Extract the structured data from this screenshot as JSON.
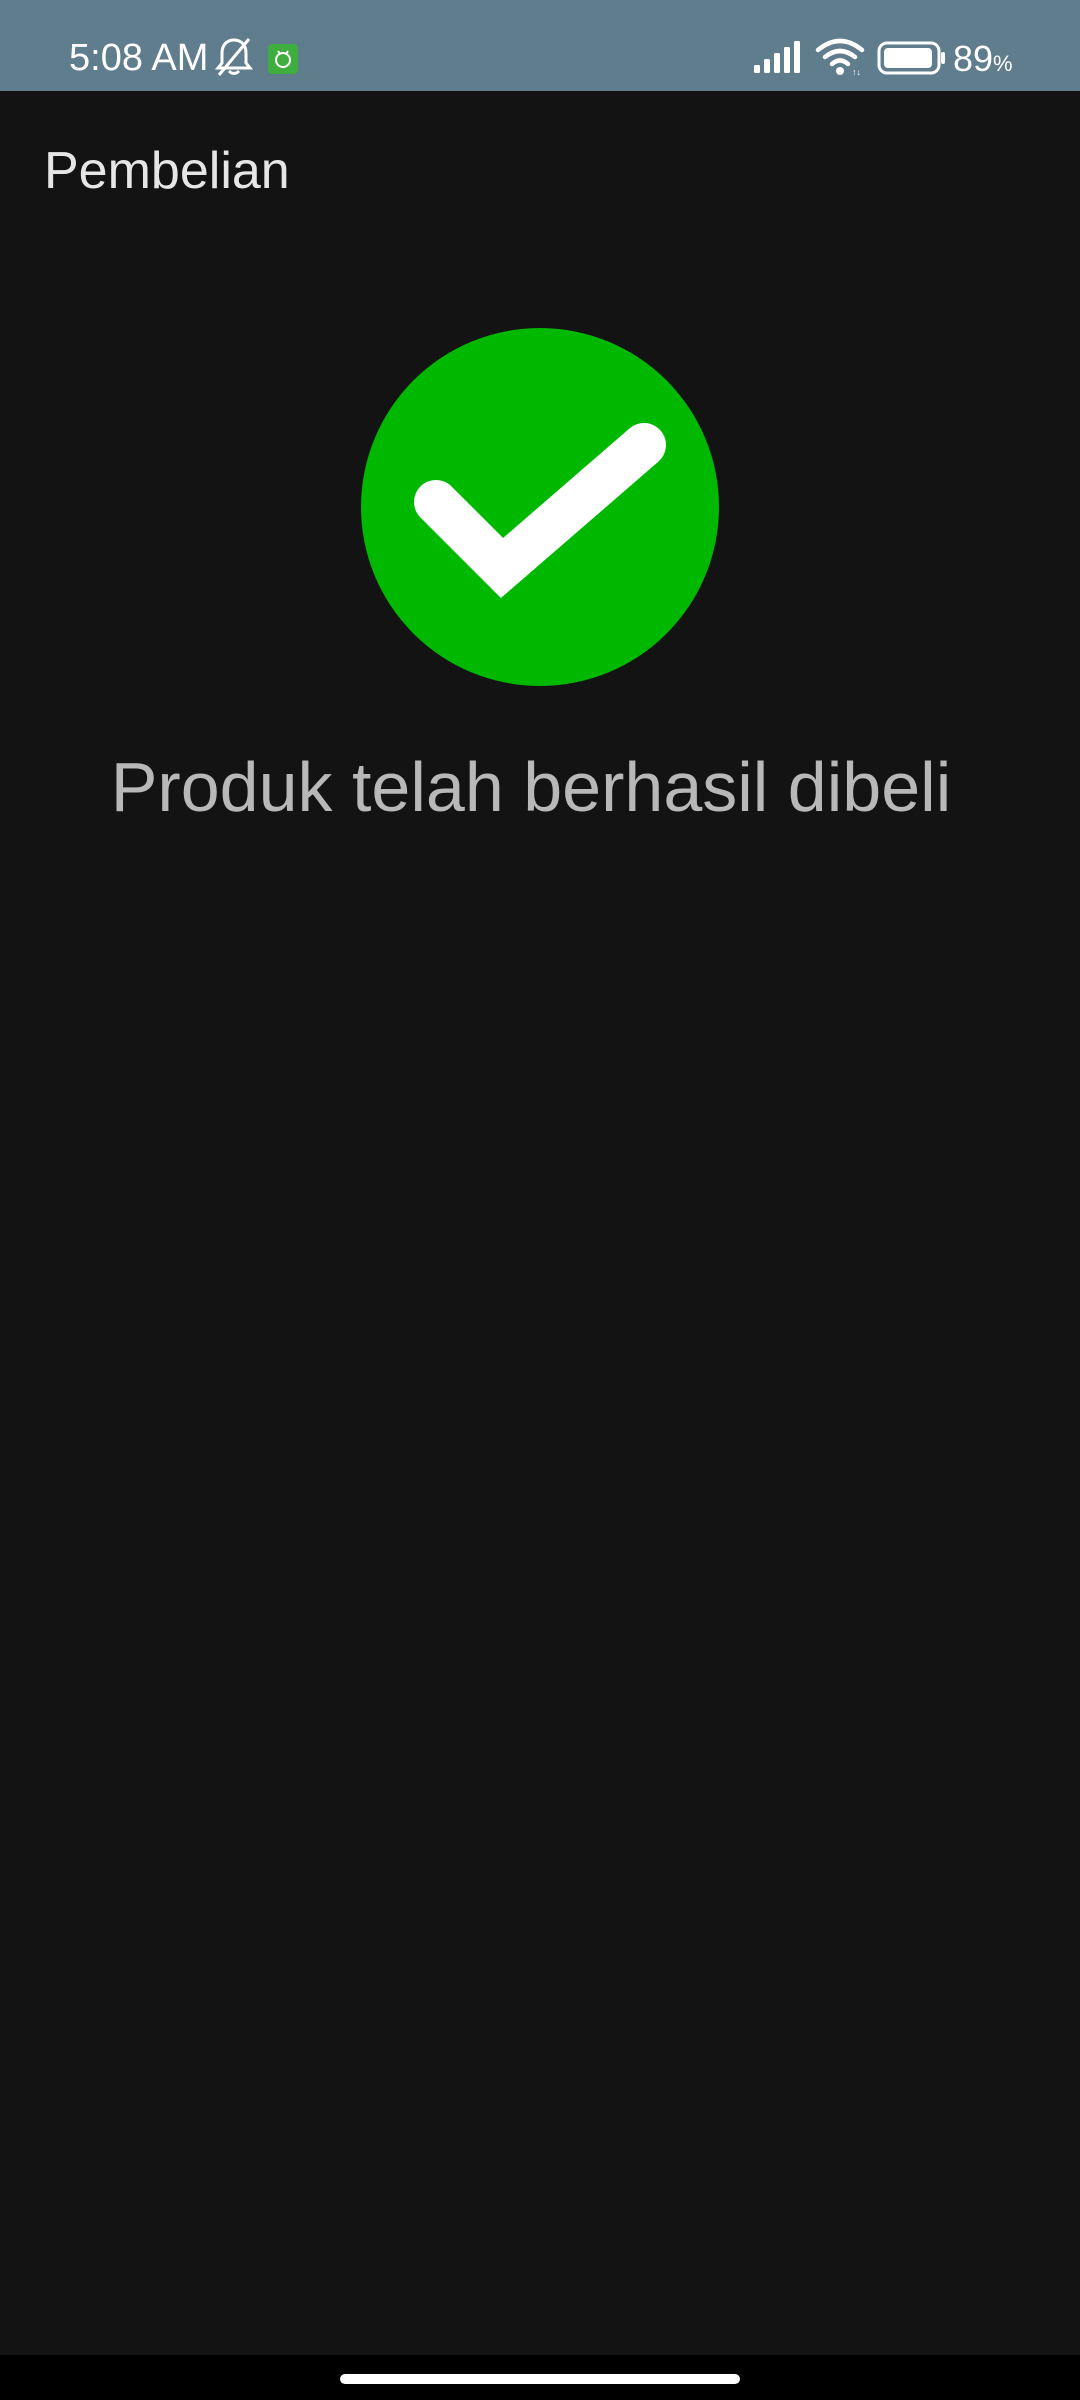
{
  "status_bar": {
    "time": "5:08 AM",
    "battery_level": "89",
    "battery_unit": "%",
    "icons": [
      "bell-off-icon",
      "app-notification-icon",
      "signal-icon",
      "wifi-icon",
      "battery-icon"
    ],
    "background_color": "#5f7d8c"
  },
  "app_bar": {
    "title": "Pembelian"
  },
  "main": {
    "success_icon": "check-circle-icon",
    "success_color": "#00b800",
    "message": "Produk telah berhasil dibeli"
  },
  "theme": {
    "background": "#131313",
    "title_color": "#e6e6e6",
    "message_color": "#b8b8b8"
  }
}
